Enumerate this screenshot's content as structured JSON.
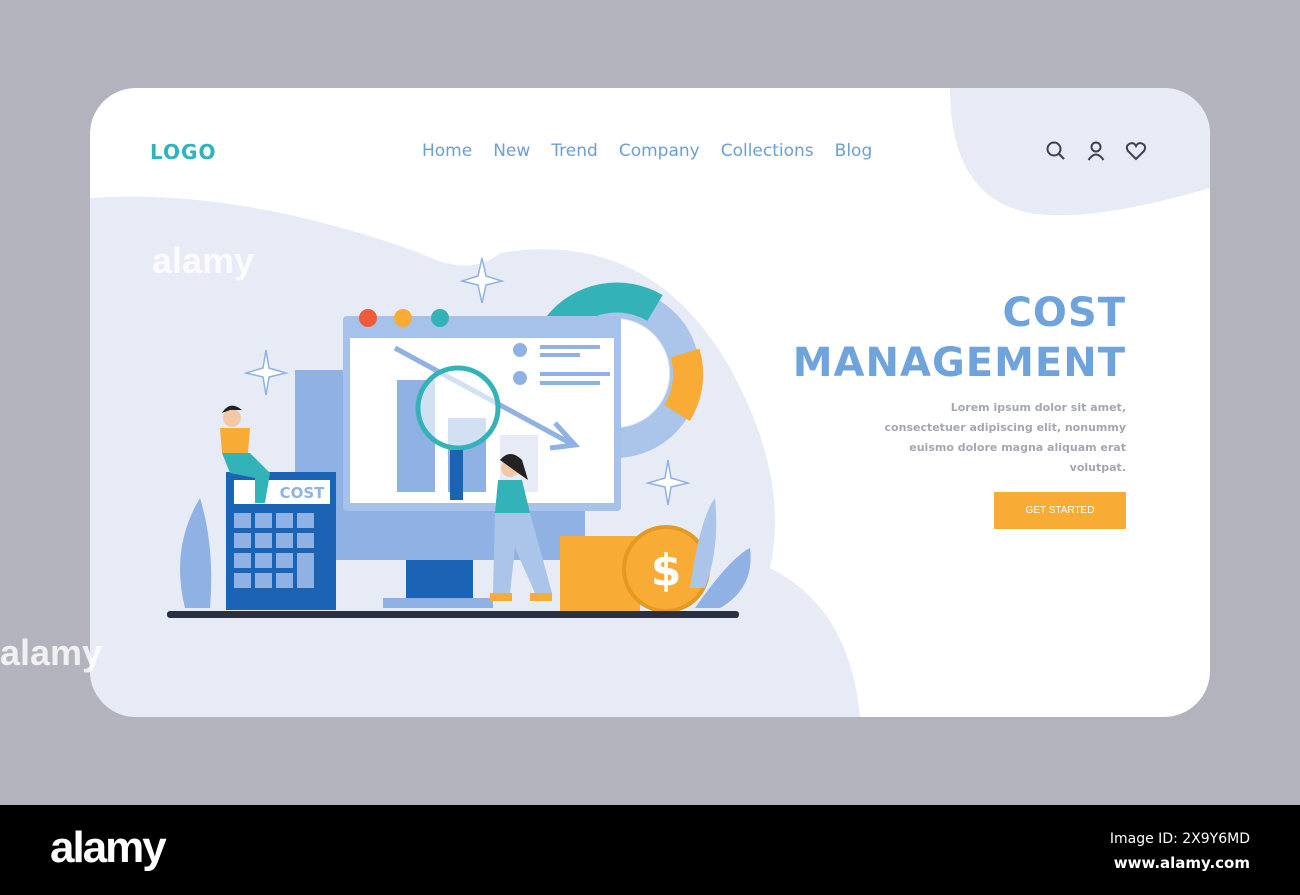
{
  "header": {
    "logo": "LOGO",
    "nav": [
      "Home",
      "New",
      "Trend",
      "Company",
      "Collections",
      "Blog"
    ],
    "icons": [
      "search-icon",
      "user-icon",
      "heart-icon"
    ]
  },
  "hero": {
    "title_line1": "COST",
    "title_line2": "MANAGEMENT",
    "description": "Lorem ipsum dolor sit amet, consectetuer adipiscing elit, nonummy euismo dolore magna aliquam erat volutpat.",
    "cta": "GET STARTED"
  },
  "illustration": {
    "calculator_label": "COST",
    "coin_symbol": "$"
  },
  "watermark": {
    "text": "alamy",
    "image_id": "Image ID: 2X9Y6MD",
    "url": "www.alamy.com"
  },
  "colors": {
    "accent_blue": "#6fa3dc",
    "logo_teal": "#2fb3bd",
    "cta_orange": "#f8ac36",
    "panel_bg": "#e7ebf6"
  }
}
